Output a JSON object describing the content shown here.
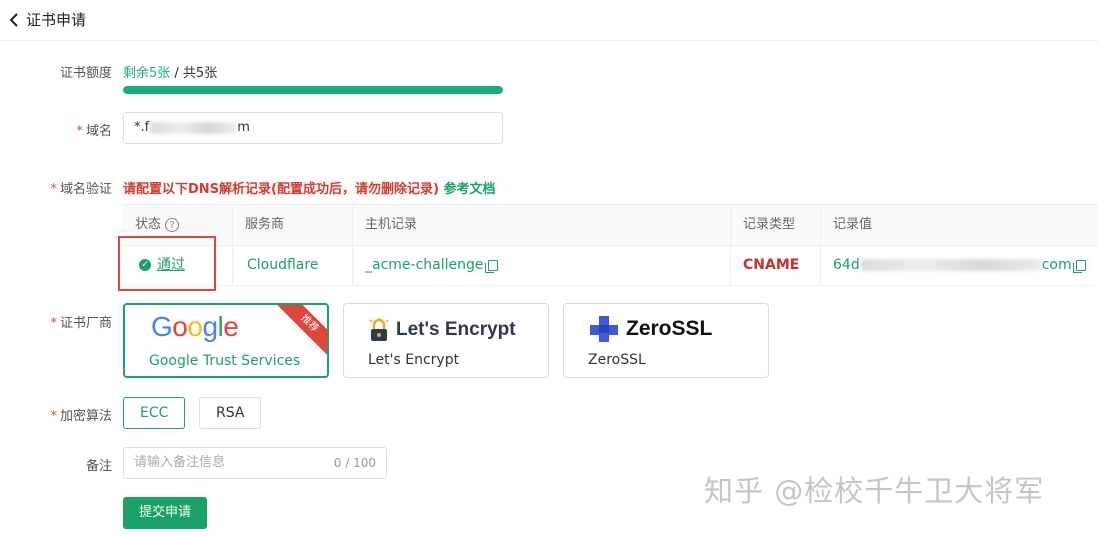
{
  "header": {
    "back_icon": "chevron-left-icon",
    "title": "证书申请"
  },
  "quota": {
    "label": "证书额度",
    "remaining": "剩余5张",
    "total": " / 共5张",
    "fraction_remaining": 1.0,
    "bar_color": "#18b078"
  },
  "domain": {
    "label": "域名",
    "value_prefix": "*.f",
    "value_suffix": "m"
  },
  "dns_verify": {
    "label": "域名验证",
    "instruction": "请配置以下DNS解析记录(配置成功后，请勿删除记录)",
    "doc_link": "参考文档",
    "columns": [
      "状态",
      "服务商",
      "主机记录",
      "记录类型",
      "记录值"
    ],
    "row": {
      "status": "通过",
      "provider": "Cloudflare",
      "host": "_acme-challenge",
      "type": "CNAME",
      "value_prefix": "64d",
      "value_suffix": "com"
    }
  },
  "ca": {
    "label": "证书厂商",
    "options": [
      {
        "logo_text": "Google",
        "name": "Google Trust Services",
        "badge": "推荐",
        "selected": true
      },
      {
        "logo_text": "Let's Encrypt",
        "name": "Let's Encrypt",
        "selected": false
      },
      {
        "logo_text": "ZeroSSL",
        "name": "ZeroSSL",
        "selected": false
      }
    ]
  },
  "algorithm": {
    "label": "加密算法",
    "options": [
      "ECC",
      "RSA"
    ],
    "selected": "ECC"
  },
  "remark": {
    "label": "备注",
    "placeholder": "请输入备注信息",
    "counter": "0 / 100"
  },
  "submit_label": "提交申请",
  "watermark": "知乎 @检校千牛卫大将军",
  "colors": {
    "primary": "#19a368",
    "danger": "#d63b2f",
    "required": "#e0463a"
  }
}
